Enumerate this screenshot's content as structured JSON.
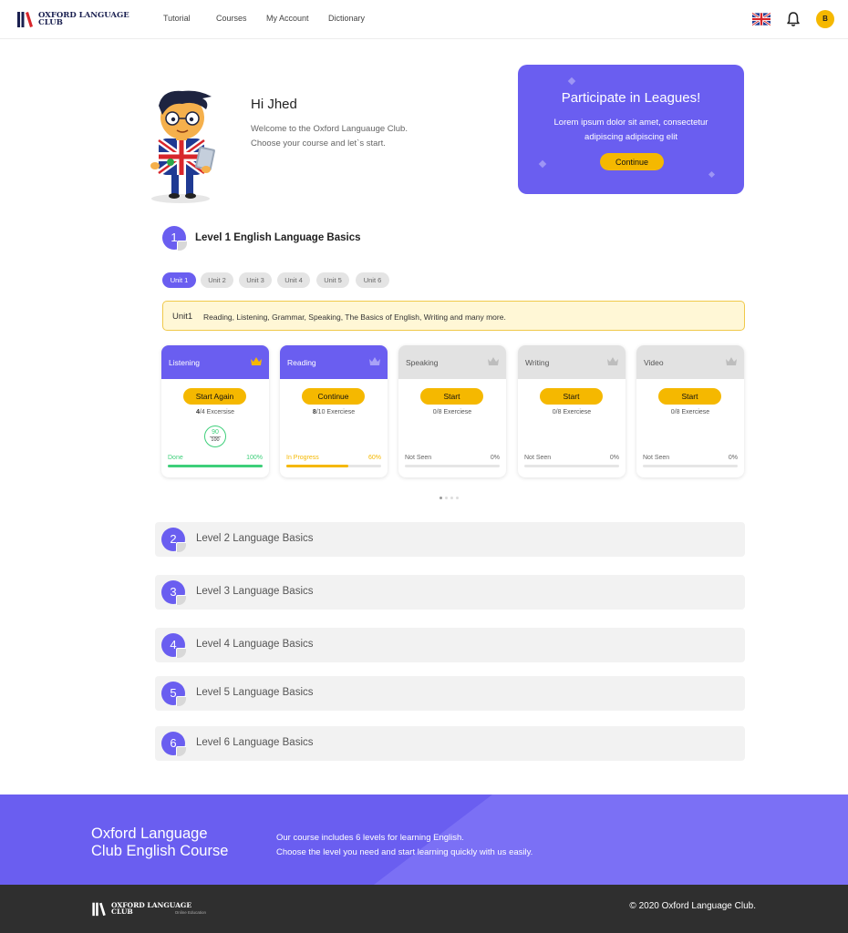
{
  "header": {
    "logo_line1": "OXFORD LANGUAGE",
    "logo_line2": "CLUB",
    "nav": [
      "Tutorial",
      "Courses",
      "My Account",
      "Dictionary"
    ],
    "language_flag": "uk-flag-icon",
    "notifications_icon": "bell-icon",
    "user_initial": "B"
  },
  "hero": {
    "greeting": "Hi Jhed",
    "welcome_line1": "Welcome to the Oxford Languauge Club.",
    "welcome_line2": "Choose your course and let`s start."
  },
  "league": {
    "title": "Participate in Leagues!",
    "text": "Lorem ipsum dolor sit amet,  consectetur adipiscing adipiscing elit",
    "button": "Continue"
  },
  "level1": {
    "number": "1",
    "title": "Level 1 English Language Basics",
    "units": [
      "Unit 1",
      "Unit 2",
      "Unit 3",
      "Unit 4",
      "Unit 5",
      "Unit 6"
    ],
    "active_unit": "Unit 1",
    "banner_label": "Unit1",
    "banner_text": "Reading, Listening, Grammar, Speaking, The Basics of English, Writing and many more.",
    "skills": [
      {
        "name": "Listening",
        "button": "Start Again",
        "done": "4",
        "ex_rest": "/4 Excersise",
        "status": "Done",
        "percent": "100%",
        "progress": 1.0,
        "score": "90",
        "score_max": "100"
      },
      {
        "name": "Reading",
        "button": "Continue",
        "done": "8",
        "ex_rest": "/10 Exerciese",
        "status": "In Progress",
        "percent": "60%",
        "progress": 0.65
      },
      {
        "name": "Speaking",
        "button": "Start",
        "done": "",
        "ex_rest": "0/8 Exerciese",
        "status": "Not Seen",
        "percent": "0%",
        "progress": 0
      },
      {
        "name": "Writing",
        "button": "Start",
        "done": "",
        "ex_rest": "0/8 Exerciese",
        "status": "Not Seen",
        "percent": "0%",
        "progress": 0
      },
      {
        "name": "Video",
        "button": "Start",
        "done": "",
        "ex_rest": "0/8 Exerciese",
        "status": "Not Seen",
        "percent": "0%",
        "progress": 0
      }
    ]
  },
  "levels": [
    {
      "number": "2",
      "title": "Level 2 Language Basics"
    },
    {
      "number": "3",
      "title": "Level 3 Language Basics"
    },
    {
      "number": "4",
      "title": "Level 4 Language Basics"
    },
    {
      "number": "5",
      "title": "Level 5 Language Basics"
    },
    {
      "number": "6",
      "title": "Level 6 Language Basics"
    }
  ],
  "footer": {
    "title_line1": "Oxford Language",
    "title_line2": "Club English Course",
    "desc_line1": "Our course includes 6 levels for learning English.",
    "desc_line2": "Choose the level you need and start learning quickly with us easily.",
    "logo_line1": "OXFORD LANGUAGE",
    "logo_line2": "CLUB",
    "logo_sub": "Online Education",
    "copyright": "© 2020 Oxford Language Club."
  },
  "colors": {
    "accent": "#6a5ef0",
    "button": "#f5b800",
    "done_green": "#3ecf7a",
    "progress_yellow": "#f5b800"
  }
}
